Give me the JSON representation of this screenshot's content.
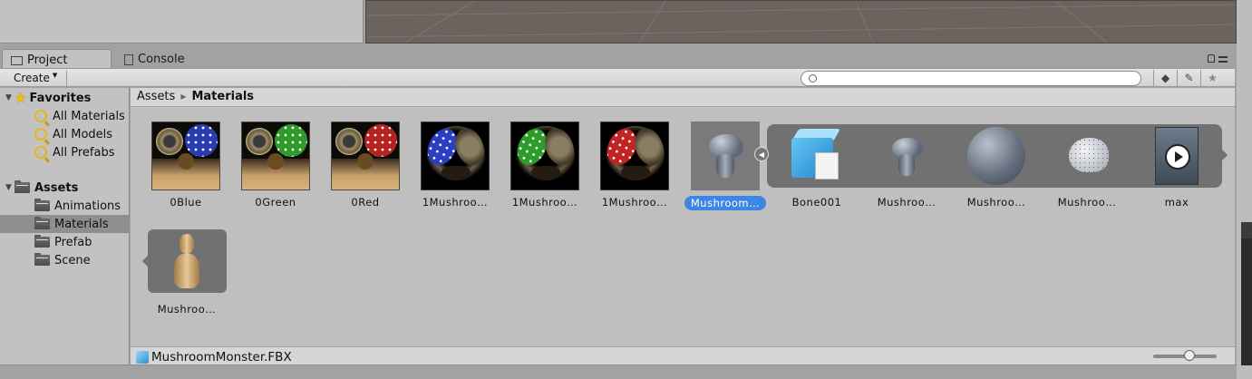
{
  "tabs": [
    {
      "label": "Project",
      "icon": "folder-icon"
    },
    {
      "label": "Console",
      "icon": "console-icon"
    }
  ],
  "toolbar": {
    "create_label": "Create",
    "search_placeholder": ""
  },
  "sidebar": {
    "favorites_label": "Favorites",
    "favorites": [
      "All Materials",
      "All Models",
      "All Prefabs"
    ],
    "assets_label": "Assets",
    "folders": [
      "Animations",
      "Materials",
      "Prefab",
      "Scene"
    ],
    "selected_folder": "Materials"
  },
  "breadcrumb": {
    "root": "Assets",
    "current": "Materials"
  },
  "assets": [
    {
      "label": "0Blue"
    },
    {
      "label": "0Green"
    },
    {
      "label": "0Red"
    },
    {
      "label": "1Mushroo…"
    },
    {
      "label": "1Mushroo…"
    },
    {
      "label": "1Mushroo…"
    },
    {
      "label": "Mushroom…",
      "selected": true
    }
  ],
  "sub_assets": [
    {
      "label": "Bone001"
    },
    {
      "label": "Mushroo…"
    },
    {
      "label": "Mushroo…"
    },
    {
      "label": "Mushroo…"
    },
    {
      "label": "max"
    },
    {
      "label": "Mushroo…"
    }
  ],
  "footer": {
    "selected_file": "MushroomMonster.FBX"
  },
  "colors": {
    "selection_blue": "#3d86e3",
    "panel_gray": "#c2c2c2",
    "scene_bg": "#6b635e"
  }
}
